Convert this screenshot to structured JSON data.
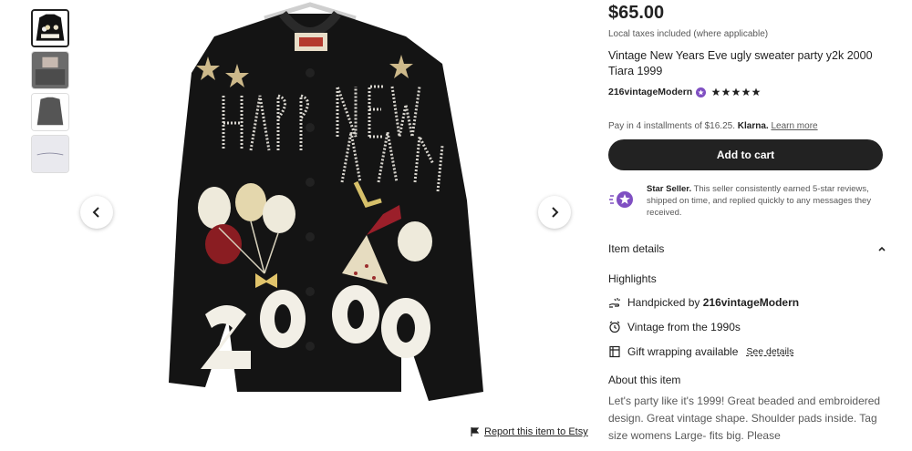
{
  "product": {
    "price": "$65.00",
    "tax_note": "Local taxes included (where applicable)",
    "title": "Vintage New Years Eve ugly sweater party y2k 2000 Tiara 1999",
    "seller_name": "216vintageModern",
    "rating_stars": 5
  },
  "klarna": {
    "prefix": "Pay in 4 installments of $16.25.",
    "brand": "Klarna.",
    "learn_more": "Learn more"
  },
  "cart": {
    "button_label": "Add to cart"
  },
  "star_seller": {
    "label": "Star Seller.",
    "description": "This seller consistently earned 5-star reviews, shipped on time, and replied quickly to any messages they received."
  },
  "item_details": {
    "toggle_label": "Item details",
    "highlights_heading": "Highlights",
    "highlights": [
      {
        "icon": "hand-icon",
        "prefix": "Handpicked by",
        "strong": "216vintageModern"
      },
      {
        "icon": "clock-icon",
        "text": "Vintage from the 1990s"
      },
      {
        "icon": "gift-icon",
        "text": "Gift wrapping available",
        "link": "See details"
      }
    ]
  },
  "about": {
    "heading": "About this item",
    "text": "Let's party like it's 1999! Great beaded and embroidered design. Great vintage shape. Shoulder pads inside. Tag size womens Large- fits big. Please"
  },
  "gallery": {
    "thumbnails": [
      "sweater-front",
      "sweater-tag",
      "sweater-back",
      "sweater-note"
    ],
    "active_index": 0,
    "report_label": "Report this item to Etsy"
  },
  "colors": {
    "accent_purple": "#7f4fc2",
    "button_dark": "#222222"
  }
}
